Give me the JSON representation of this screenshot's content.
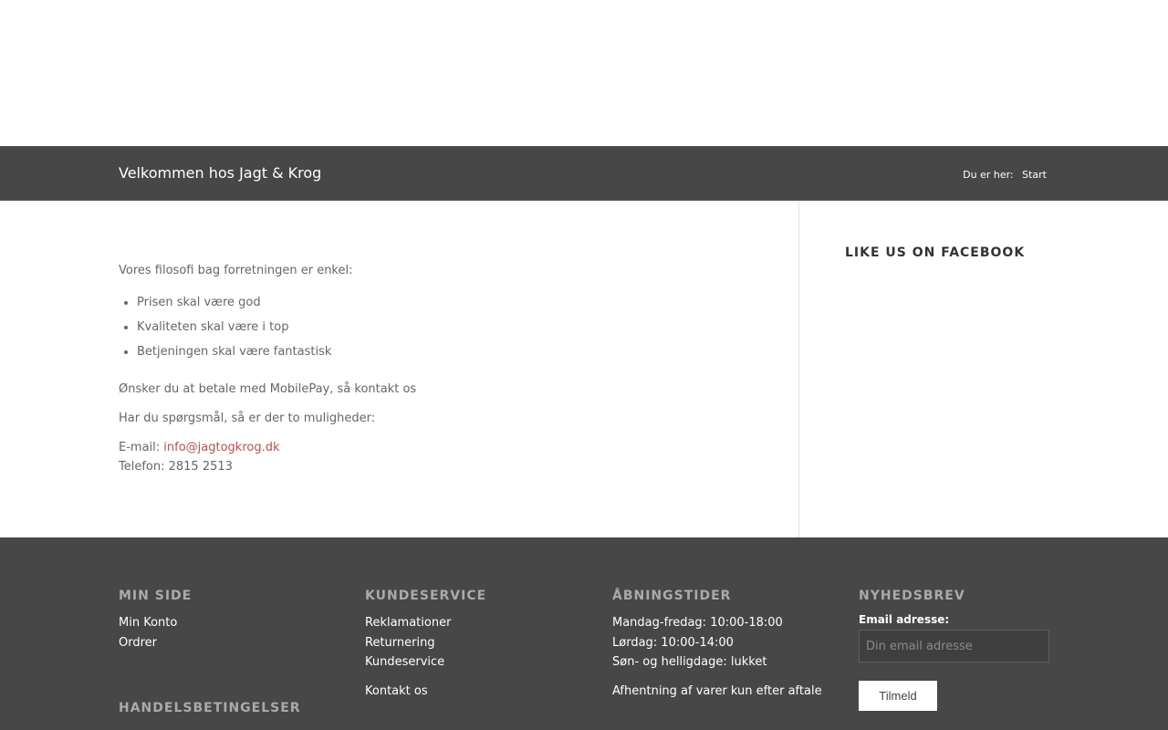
{
  "title_bar": {
    "title": "Velkommen hos Jagt & Krog",
    "breadcrumb_prefix": "Du er her:",
    "breadcrumb_current": "Start"
  },
  "main": {
    "intro": "Vores filosofi bag forretningen er enkel:",
    "bullets": [
      "Prisen skal være god",
      "Kvaliteten skal være i top",
      "Betjeningen skal være fantastisk"
    ],
    "mobilepay": "Ønsker du at betale med MobilePay, så kontakt os",
    "questions": "Har du spørgsmål, så er der to muligheder:",
    "email_label": "E-mail:",
    "email": "info@jagtogkrog.dk",
    "phone": "Telefon: 2815 2513"
  },
  "sidebar": {
    "title": "LIKE US ON FACEBOOK"
  },
  "footer": {
    "min_side": {
      "title": "MIN SIDE",
      "links": [
        "Min Konto",
        "Ordrer"
      ]
    },
    "handelsbetingelser": {
      "title": "HANDELSBETINGELSER"
    },
    "kundeservice": {
      "title": "KUNDESERVICE",
      "links": [
        "Reklamationer",
        "Returnering",
        "Kundeservice"
      ],
      "contact": "Kontakt os"
    },
    "aabningstider": {
      "title": "ÅBNINGSTIDER",
      "lines": [
        "Mandag-fredag: 10:00-18:00",
        "Lørdag: 10:00-14:00",
        "Søn- og helligdage: lukket"
      ],
      "note": "Afhentning af varer kun efter aftale"
    },
    "nyhedsbrev": {
      "title": "NYHEDSBREV",
      "label": "Email adresse:",
      "placeholder": "Din email adresse",
      "button": "Tilmeld"
    }
  },
  "colors": {
    "bar_bg": "#474747",
    "link": "#c0504d"
  }
}
